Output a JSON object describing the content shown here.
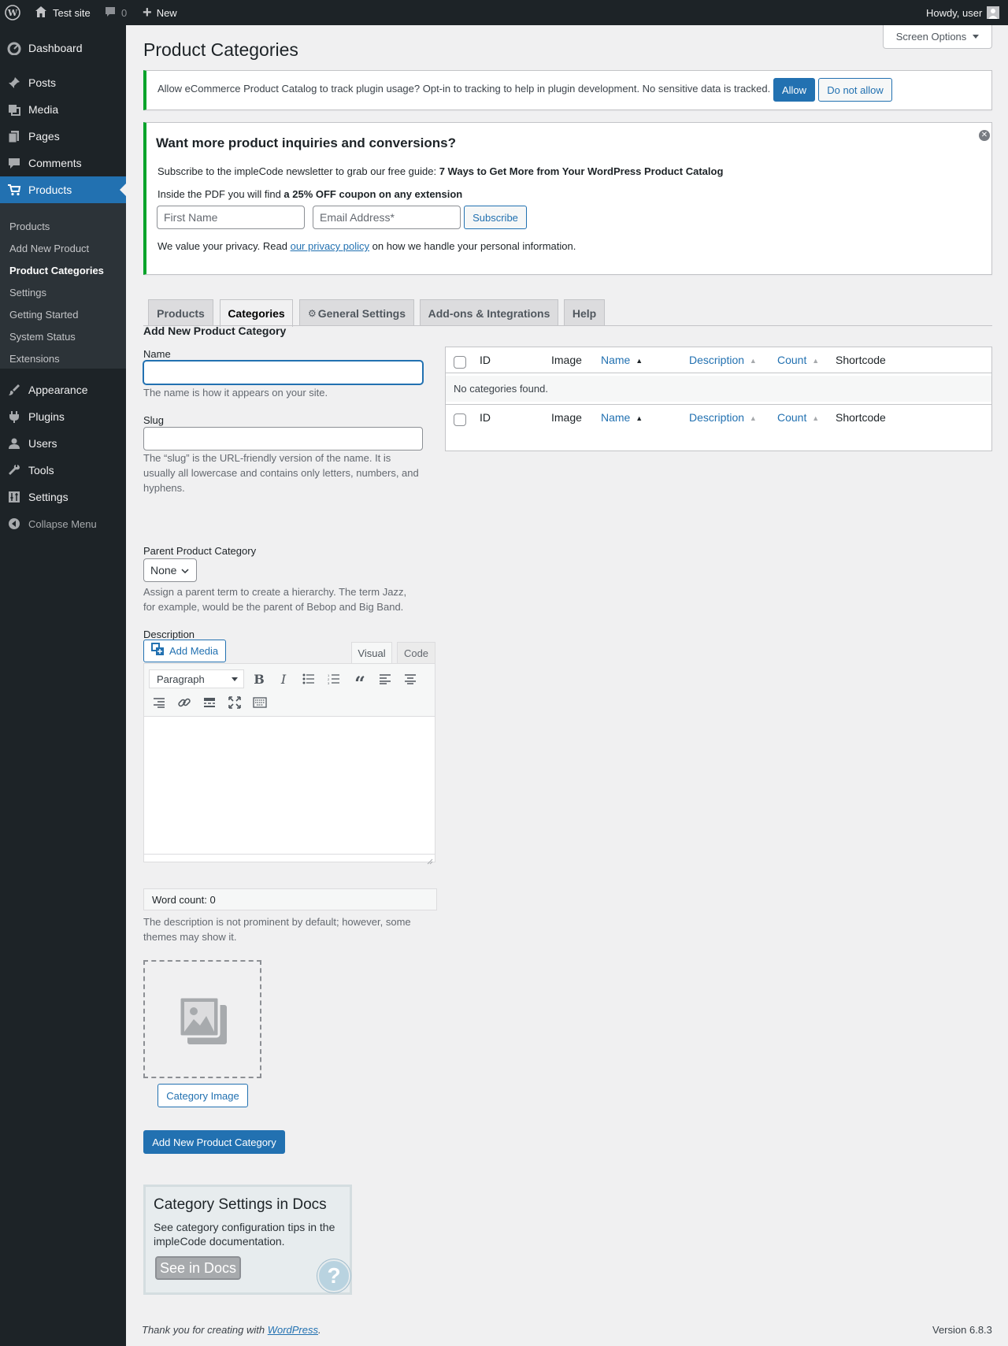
{
  "adminbar": {
    "site_name": "Test site",
    "comments_count": "0",
    "new_label": "New",
    "howdy": "Howdy, user"
  },
  "menu": {
    "dashboard": "Dashboard",
    "posts": "Posts",
    "media": "Media",
    "pages": "Pages",
    "comments": "Comments",
    "products": "Products",
    "appearance": "Appearance",
    "plugins": "Plugins",
    "users": "Users",
    "tools": "Tools",
    "settings": "Settings",
    "collapse": "Collapse Menu",
    "submenu": [
      "Products",
      "Add New Product",
      "Product Categories",
      "Settings",
      "Getting Started",
      "System Status",
      "Extensions"
    ]
  },
  "page": {
    "title": "Product Categories",
    "screen_options": "Screen Options"
  },
  "tracking_notice": {
    "text": "Allow eCommerce Product Catalog to track plugin usage? Opt-in to tracking to help in plugin development. No sensitive data is tracked.",
    "allow": "Allow",
    "disallow": "Do not allow"
  },
  "newsletter": {
    "heading": "Want more product inquiries and conversions?",
    "line1_prefix": "Subscribe to the impleCode newsletter to grab our free guide: ",
    "line1_bold": "7 Ways to Get More from Your WordPress Product Catalog",
    "line2_prefix": "Inside the PDF you will find ",
    "line2_bold": "a 25% OFF coupon on any extension",
    "first_name_placeholder": "First Name",
    "email_placeholder": "Email Address*",
    "subscribe": "Subscribe",
    "privacy_prefix": "We value your privacy. Read ",
    "privacy_link": "our privacy policy",
    "privacy_suffix": " on how we handle your personal information."
  },
  "tabs": [
    "Products",
    "Categories",
    "General Settings",
    "Add-ons & Integrations",
    "Help"
  ],
  "form": {
    "heading": "Add New Product Category",
    "name_label": "Name",
    "name_value": "",
    "name_desc": "The name is how it appears on your site.",
    "slug_label": "Slug",
    "slug_value": "",
    "slug_desc": "The “slug” is the URL-friendly version of the name. It is usually all lowercase and contains only letters, numbers, and hyphens.",
    "parent_label": "Parent Product Category",
    "parent_value": "None",
    "parent_desc": "Assign a parent term to create a hierarchy. The term Jazz, for example, would be the parent of Bebop and Big Band.",
    "description_label": "Description",
    "add_media": "Add Media",
    "visual_tab": "Visual",
    "code_tab": "Code",
    "format_select": "Paragraph",
    "word_count": "Word count: 0",
    "description_desc": "The description is not prominent by default; however, some themes may show it.",
    "category_image_button": "Category Image",
    "submit": "Add New Product Category"
  },
  "table": {
    "columns": [
      "ID",
      "Image",
      "Name",
      "Description",
      "Count",
      "Shortcode"
    ],
    "empty_message": "No categories found."
  },
  "docs_box": {
    "title": "Category Settings in Docs",
    "text": "See category configuration tips in the impleCode documentation.",
    "button": "See in Docs"
  },
  "footer": {
    "thanks_prefix": "Thank you for creating with ",
    "thanks_link": "WordPress",
    "thanks_suffix": ".",
    "version": "Version 6.8.3"
  },
  "colors": {
    "admin_dark": "#1d2327",
    "accent_blue": "#2271b1",
    "notice_green": "#00a32a"
  }
}
